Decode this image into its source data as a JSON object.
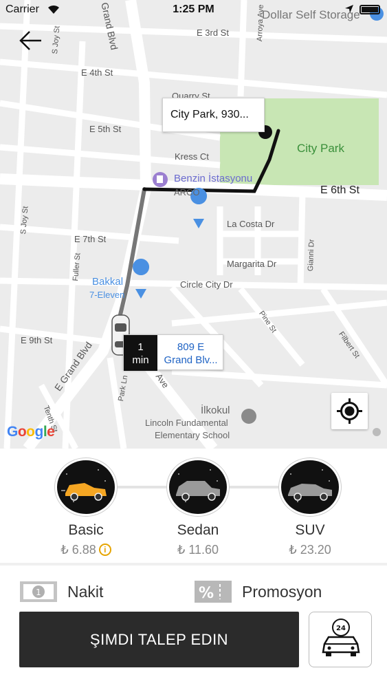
{
  "status_bar": {
    "carrier": "Carrier",
    "time": "1:25 PM"
  },
  "map": {
    "streets": [
      "E 3rd St",
      "E 4th St",
      "E 5th St",
      "E 6th St",
      "E 7th St",
      "E 9th St",
      "Grand Blvd",
      "Arroya Ave",
      "Quarry St",
      "Kress Ct",
      "La Costa Dr",
      "Margarita Dr",
      "Circle City Dr",
      "Gianni Dr",
      "Pine St",
      "Filbert St",
      "S Joy St",
      "Fuller St",
      "E Grand Blvd",
      "Park Ln",
      "Tenth St",
      "Ave"
    ],
    "pois": {
      "storage": "Dollar Self Storage",
      "park": "City Park",
      "gas_station": "Benzin İstasyonu",
      "gas_brand": "ARCO",
      "grocery": "Bakkal",
      "grocery_brand": "7-Eleven",
      "school": "İlkokul",
      "school_name_line1": "Lincoln Fundamental",
      "school_name_line2": "Elementary School"
    },
    "destination_callout": "City Park,  930...",
    "eta": {
      "value": "1",
      "unit": "min",
      "address_line1": "809 E",
      "address_line2": "Grand Blv..."
    },
    "attribution": "Google",
    "route_color": "#111111",
    "park_color": "#c8e6b4"
  },
  "vehicles": [
    {
      "name": "Basic",
      "price": "₺ 6.88",
      "selected": true,
      "car_color": "#f5a623",
      "has_info": true
    },
    {
      "name": "Sedan",
      "price": "₺ 11.60",
      "selected": false,
      "car_color": "#9a9a9a",
      "has_info": false
    },
    {
      "name": "SUV",
      "price": "₺ 23.20",
      "selected": false,
      "car_color": "#9a9a9a",
      "has_info": false
    }
  ],
  "payment": {
    "label": "Nakit",
    "icon": "cash-icon"
  },
  "promo": {
    "label": "Promosyon",
    "icon": "percent-icon"
  },
  "request_button": "ŞIMDI TALEP EDIN",
  "schedule_badge": "24"
}
